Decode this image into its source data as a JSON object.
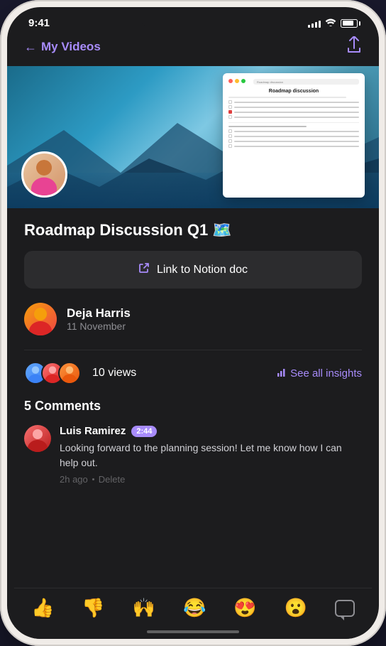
{
  "status_bar": {
    "time": "9:41"
  },
  "nav": {
    "back_label": "My Videos",
    "share_icon": "↑"
  },
  "video": {
    "title": "Roadmap Discussion Q1 🗺️",
    "notion_title": "Roadmap discussion"
  },
  "link_button": {
    "label": "Link to Notion doc"
  },
  "author": {
    "name": "Deja Harris",
    "date": "11 November"
  },
  "views": {
    "count": "10 views",
    "insights_label": "See all insights"
  },
  "comments": {
    "header": "5 Comments",
    "items": [
      {
        "author": "Luis Ramirez",
        "time_badge": "2:44",
        "text": "Looking forward to the planning session! Let me know how I can help out.",
        "ago": "2h ago",
        "action": "Delete"
      }
    ]
  },
  "emoji_bar": {
    "emojis": [
      "👍",
      "👎",
      "🙌",
      "😂",
      "😍",
      "😮"
    ]
  }
}
